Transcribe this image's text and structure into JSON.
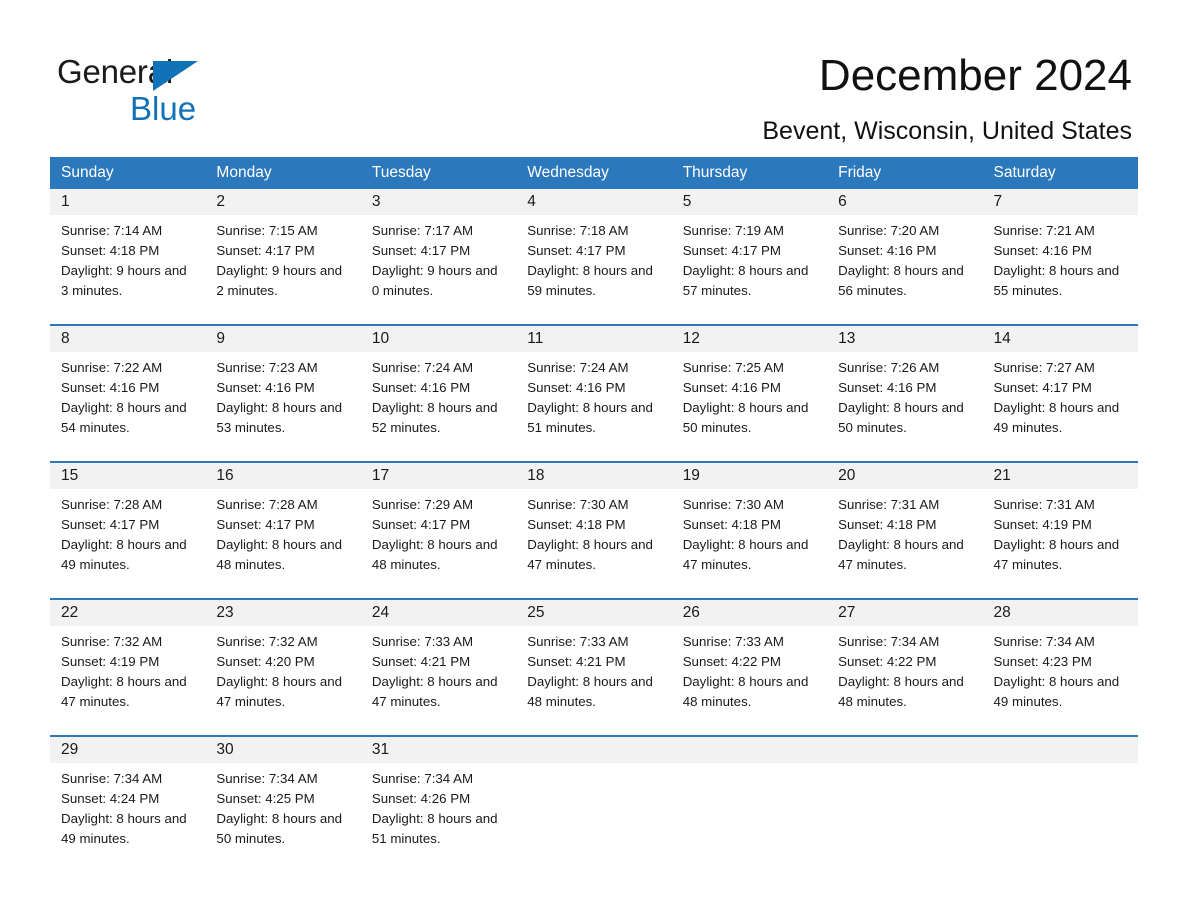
{
  "brand": {
    "line1": "General",
    "line2": "Blue",
    "triangle_color": "#1272b8"
  },
  "header": {
    "month_title": "December 2024",
    "location": "Bevent, Wisconsin, United States"
  },
  "theme": {
    "header_blue": "#2b78bd",
    "date_strip_gray": "#f2f2f2",
    "text": "#1a1a1a"
  },
  "weekdays": [
    "Sunday",
    "Monday",
    "Tuesday",
    "Wednesday",
    "Thursday",
    "Friday",
    "Saturday"
  ],
  "weeks": [
    [
      {
        "day": "1",
        "sunrise": "Sunrise: 7:14 AM",
        "sunset": "Sunset: 4:18 PM",
        "daylight": "Daylight: 9 hours and 3 minutes."
      },
      {
        "day": "2",
        "sunrise": "Sunrise: 7:15 AM",
        "sunset": "Sunset: 4:17 PM",
        "daylight": "Daylight: 9 hours and 2 minutes."
      },
      {
        "day": "3",
        "sunrise": "Sunrise: 7:17 AM",
        "sunset": "Sunset: 4:17 PM",
        "daylight": "Daylight: 9 hours and 0 minutes."
      },
      {
        "day": "4",
        "sunrise": "Sunrise: 7:18 AM",
        "sunset": "Sunset: 4:17 PM",
        "daylight": "Daylight: 8 hours and 59 minutes."
      },
      {
        "day": "5",
        "sunrise": "Sunrise: 7:19 AM",
        "sunset": "Sunset: 4:17 PM",
        "daylight": "Daylight: 8 hours and 57 minutes."
      },
      {
        "day": "6",
        "sunrise": "Sunrise: 7:20 AM",
        "sunset": "Sunset: 4:16 PM",
        "daylight": "Daylight: 8 hours and 56 minutes."
      },
      {
        "day": "7",
        "sunrise": "Sunrise: 7:21 AM",
        "sunset": "Sunset: 4:16 PM",
        "daylight": "Daylight: 8 hours and 55 minutes."
      }
    ],
    [
      {
        "day": "8",
        "sunrise": "Sunrise: 7:22 AM",
        "sunset": "Sunset: 4:16 PM",
        "daylight": "Daylight: 8 hours and 54 minutes."
      },
      {
        "day": "9",
        "sunrise": "Sunrise: 7:23 AM",
        "sunset": "Sunset: 4:16 PM",
        "daylight": "Daylight: 8 hours and 53 minutes."
      },
      {
        "day": "10",
        "sunrise": "Sunrise: 7:24 AM",
        "sunset": "Sunset: 4:16 PM",
        "daylight": "Daylight: 8 hours and 52 minutes."
      },
      {
        "day": "11",
        "sunrise": "Sunrise: 7:24 AM",
        "sunset": "Sunset: 4:16 PM",
        "daylight": "Daylight: 8 hours and 51 minutes."
      },
      {
        "day": "12",
        "sunrise": "Sunrise: 7:25 AM",
        "sunset": "Sunset: 4:16 PM",
        "daylight": "Daylight: 8 hours and 50 minutes."
      },
      {
        "day": "13",
        "sunrise": "Sunrise: 7:26 AM",
        "sunset": "Sunset: 4:16 PM",
        "daylight": "Daylight: 8 hours and 50 minutes."
      },
      {
        "day": "14",
        "sunrise": "Sunrise: 7:27 AM",
        "sunset": "Sunset: 4:17 PM",
        "daylight": "Daylight: 8 hours and 49 minutes."
      }
    ],
    [
      {
        "day": "15",
        "sunrise": "Sunrise: 7:28 AM",
        "sunset": "Sunset: 4:17 PM",
        "daylight": "Daylight: 8 hours and 49 minutes."
      },
      {
        "day": "16",
        "sunrise": "Sunrise: 7:28 AM",
        "sunset": "Sunset: 4:17 PM",
        "daylight": "Daylight: 8 hours and 48 minutes."
      },
      {
        "day": "17",
        "sunrise": "Sunrise: 7:29 AM",
        "sunset": "Sunset: 4:17 PM",
        "daylight": "Daylight: 8 hours and 48 minutes."
      },
      {
        "day": "18",
        "sunrise": "Sunrise: 7:30 AM",
        "sunset": "Sunset: 4:18 PM",
        "daylight": "Daylight: 8 hours and 47 minutes."
      },
      {
        "day": "19",
        "sunrise": "Sunrise: 7:30 AM",
        "sunset": "Sunset: 4:18 PM",
        "daylight": "Daylight: 8 hours and 47 minutes."
      },
      {
        "day": "20",
        "sunrise": "Sunrise: 7:31 AM",
        "sunset": "Sunset: 4:18 PM",
        "daylight": "Daylight: 8 hours and 47 minutes."
      },
      {
        "day": "21",
        "sunrise": "Sunrise: 7:31 AM",
        "sunset": "Sunset: 4:19 PM",
        "daylight": "Daylight: 8 hours and 47 minutes."
      }
    ],
    [
      {
        "day": "22",
        "sunrise": "Sunrise: 7:32 AM",
        "sunset": "Sunset: 4:19 PM",
        "daylight": "Daylight: 8 hours and 47 minutes."
      },
      {
        "day": "23",
        "sunrise": "Sunrise: 7:32 AM",
        "sunset": "Sunset: 4:20 PM",
        "daylight": "Daylight: 8 hours and 47 minutes."
      },
      {
        "day": "24",
        "sunrise": "Sunrise: 7:33 AM",
        "sunset": "Sunset: 4:21 PM",
        "daylight": "Daylight: 8 hours and 47 minutes."
      },
      {
        "day": "25",
        "sunrise": "Sunrise: 7:33 AM",
        "sunset": "Sunset: 4:21 PM",
        "daylight": "Daylight: 8 hours and 48 minutes."
      },
      {
        "day": "26",
        "sunrise": "Sunrise: 7:33 AM",
        "sunset": "Sunset: 4:22 PM",
        "daylight": "Daylight: 8 hours and 48 minutes."
      },
      {
        "day": "27",
        "sunrise": "Sunrise: 7:34 AM",
        "sunset": "Sunset: 4:22 PM",
        "daylight": "Daylight: 8 hours and 48 minutes."
      },
      {
        "day": "28",
        "sunrise": "Sunrise: 7:34 AM",
        "sunset": "Sunset: 4:23 PM",
        "daylight": "Daylight: 8 hours and 49 minutes."
      }
    ],
    [
      {
        "day": "29",
        "sunrise": "Sunrise: 7:34 AM",
        "sunset": "Sunset: 4:24 PM",
        "daylight": "Daylight: 8 hours and 49 minutes."
      },
      {
        "day": "30",
        "sunrise": "Sunrise: 7:34 AM",
        "sunset": "Sunset: 4:25 PM",
        "daylight": "Daylight: 8 hours and 50 minutes."
      },
      {
        "day": "31",
        "sunrise": "Sunrise: 7:34 AM",
        "sunset": "Sunset: 4:26 PM",
        "daylight": "Daylight: 8 hours and 51 minutes."
      },
      {
        "day": "",
        "sunrise": "",
        "sunset": "",
        "daylight": ""
      },
      {
        "day": "",
        "sunrise": "",
        "sunset": "",
        "daylight": ""
      },
      {
        "day": "",
        "sunrise": "",
        "sunset": "",
        "daylight": ""
      },
      {
        "day": "",
        "sunrise": "",
        "sunset": "",
        "daylight": ""
      }
    ]
  ]
}
